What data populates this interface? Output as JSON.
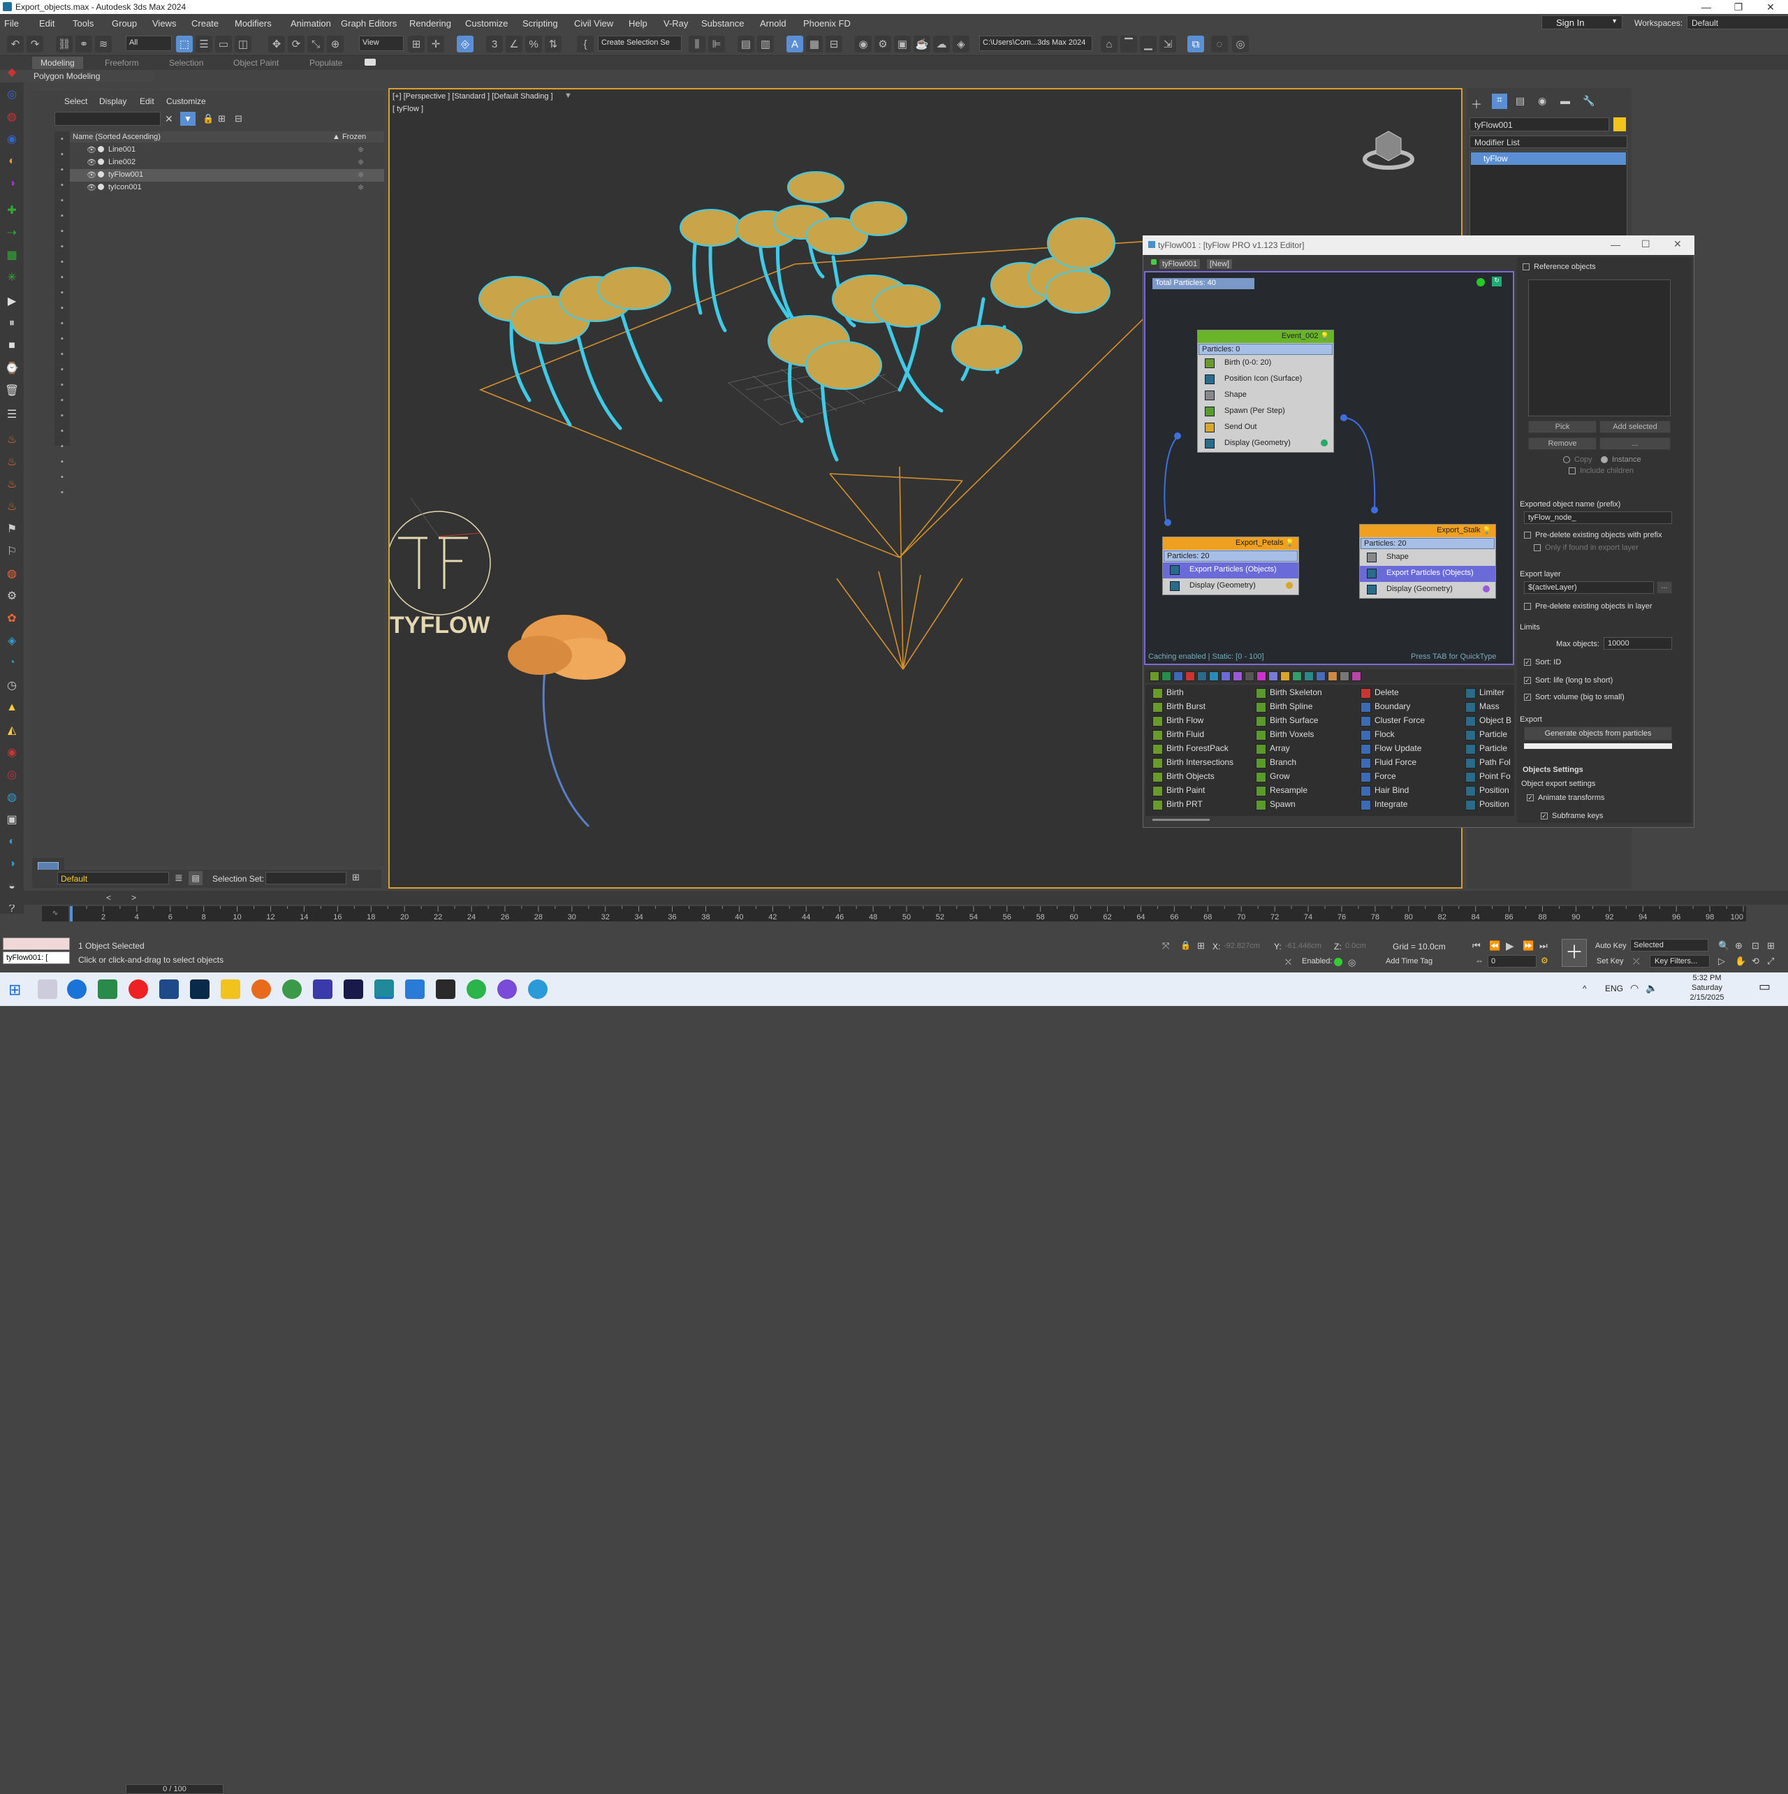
{
  "window": {
    "title": "Export_objects.max - Autodesk 3ds Max 2024"
  },
  "menu": [
    "File",
    "Edit",
    "Tools",
    "Group",
    "Views",
    "Create",
    "Modifiers",
    "Animation",
    "Graph Editors",
    "Rendering",
    "Customize",
    "Scripting",
    "Civil View",
    "Help",
    "V-Ray",
    "Substance",
    "Arnold",
    "Phoenix FD"
  ],
  "account": {
    "signin": "Sign In",
    "workspaces_label": "Workspaces:",
    "workspace": "Default"
  },
  "toolbar": {
    "filter": "All",
    "refcoord": "View",
    "selection_set": "Create Selection Se",
    "path": "C:\\Users\\Com...3ds Max 2024"
  },
  "ribbon": {
    "tabs": [
      "Modeling",
      "Freeform",
      "Selection",
      "Object Paint",
      "Populate"
    ],
    "subtab": "Polygon Modeling"
  },
  "scene_explorer": {
    "menu": [
      "Select",
      "Display",
      "Edit",
      "Customize"
    ],
    "col_name": "Name (Sorted Ascending)",
    "col_frozen": "▲ Frozen",
    "rows": [
      {
        "name": "Line001"
      },
      {
        "name": "Line002"
      },
      {
        "name": "tyFlow001"
      },
      {
        "name": "tyIcon001"
      }
    ],
    "layer": "Default",
    "selection_set_label": "Selection Set:"
  },
  "viewport": {
    "label": "[+] [Perspective ] [Standard ] [Default Shading ]",
    "label2": "[ tyFlow ]",
    "logo": "TYFLOW"
  },
  "command_panel": {
    "object_name": "tyFlow001",
    "modifier_list": "Modifier List",
    "modifier": "tyFlow",
    "object_color": "#f2c21d"
  },
  "tyflow_editor": {
    "title": "tyFlow001 : [tyFlow PRO v1.123 Editor]",
    "tabs": [
      "tyFlow001",
      "[New]"
    ],
    "total_particles": "Total Particles: 40",
    "footer_left": "Caching enabled | Static: [0 - 100]",
    "footer_right": "Press TAB for QuickType",
    "event_main": {
      "name": "Event_002",
      "particles": "Particles: 0",
      "ops": [
        "Birth (0-0: 20)",
        "Position Icon (Surface)",
        "Shape",
        "Spawn (Per Step)",
        "Send Out",
        "Display (Geometry)"
      ]
    },
    "event_petals": {
      "name": "Export_Petals",
      "particles": "Particles: 20",
      "ops": [
        "Export Particles (Objects)",
        "Display (Geometry)"
      ]
    },
    "event_stalk": {
      "name": "Export_Stalk",
      "particles": "Particles: 20",
      "ops": [
        "Shape",
        "Export Particles (Objects)",
        "Display (Geometry)"
      ]
    },
    "operators": [
      [
        "Birth",
        "Birth Burst",
        "Birth Flow",
        "Birth Fluid",
        "Birth ForestPack",
        "Birth Intersections",
        "Birth Objects",
        "Birth Paint",
        "Birth PRT"
      ],
      [
        "Birth Skeleton",
        "Birth Spline",
        "Birth Surface",
        "Birth Voxels",
        "Array",
        "Branch",
        "Grow",
        "Resample",
        "Spawn"
      ],
      [
        "Delete",
        "Boundary",
        "Cluster Force",
        "Flock",
        "Flow Update",
        "Fluid Force",
        "Force",
        "Hair Bind",
        "Integrate"
      ],
      [
        "Limiter",
        "Mass",
        "Object B",
        "Particle",
        "Particle",
        "Path Fol",
        "Point Fo",
        "Position",
        "Position"
      ]
    ],
    "right": {
      "ref_objects": "Reference objects",
      "pick": "Pick",
      "add_selected": "Add selected",
      "remove": "Remove",
      "ellipsis": "...",
      "copy": "Copy",
      "instance": "Instance",
      "include_children": "Include children",
      "export_name_label": "Exported object name (prefix)",
      "export_name": "tyFlow_node_",
      "predelete_prefix": "Pre-delete existing objects with prefix",
      "only_found": "Only if found in export layer",
      "export_layer_label": "Export layer",
      "export_layer": "$(activeLayer)",
      "predelete_layer": "Pre-delete existing objects in layer",
      "limits": "Limits",
      "max_objects_label": "Max objects:",
      "max_objects": "10000",
      "sort_id": "Sort: ID",
      "sort_life": "Sort: life (long to short)",
      "sort_volume": "Sort: volume (big to small)",
      "export": "Export",
      "generate": "Generate objects from particles",
      "obj_settings": "Objects Settings",
      "obj_export_settings": "Object export settings",
      "animate": "Animate transforms",
      "subframe": "Subframe keys"
    }
  },
  "timeline": {
    "frame": "0 / 100",
    "ticks": [
      "0",
      "2",
      "4",
      "6",
      "8",
      "10",
      "12",
      "14",
      "16",
      "18",
      "20",
      "22",
      "24",
      "26",
      "28",
      "30",
      "32",
      "34",
      "36",
      "38",
      "40",
      "42",
      "44",
      "46",
      "48",
      "50",
      "52",
      "54",
      "56",
      "58",
      "60",
      "62",
      "64",
      "66",
      "68",
      "70",
      "72",
      "74",
      "76",
      "78",
      "80",
      "82",
      "84",
      "86",
      "88",
      "90",
      "92",
      "94",
      "96",
      "98",
      "100"
    ]
  },
  "status": {
    "selected": "1 Object Selected",
    "hint": "Click or click-and-drag to select objects",
    "x_label": "X:",
    "x": "-92.827cm",
    "y_label": "Y:",
    "y": "-61.446cm",
    "z_label": "Z:",
    "z": "0.0cm",
    "grid": "Grid = 10.0cm",
    "enabled": "Enabled:",
    "add_time_tag": "Add Time Tag",
    "autokey": "Auto Key",
    "selected_dd": "Selected",
    "setkey": "Set Key",
    "keyfilters": "Key Filters...",
    "frame_input": "0",
    "cmd": "tyFlow001: ["
  },
  "taskbar": {
    "lang": "ENG",
    "time": "5:32 PM",
    "day": "Saturday",
    "date": "2/15/2025"
  }
}
